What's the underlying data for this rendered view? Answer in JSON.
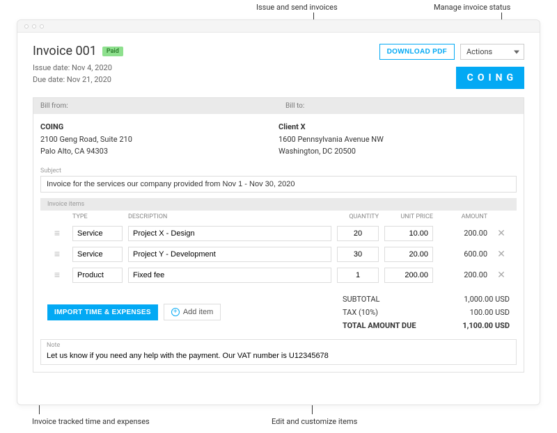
{
  "annotations": {
    "issue_send": "Issue and send invoices",
    "manage_status": "Manage invoice status",
    "invoice_tracked": "Invoice tracked time and expenses",
    "edit_items": "Edit and customize items"
  },
  "header": {
    "title": "Invoice 001",
    "status_badge": "Paid",
    "issue_date_label": "Issue date: Nov 4, 2020",
    "due_date_label": "Due date: Nov 21, 2020",
    "download_label": "DOWNLOAD PDF",
    "actions_label": "Actions",
    "logo_text": "COING"
  },
  "bill": {
    "from_label": "Bill from:",
    "to_label": "Bill to:",
    "from": {
      "company": "COING",
      "line1": "2100 Geng Road, Suite 210",
      "line2": "Palo Alto, CA 94303"
    },
    "to": {
      "company": "Client X",
      "line1": "1600 Pennsylvania Avenue NW",
      "line2": "Washington, DC 20500"
    }
  },
  "subject": {
    "label": "Subject",
    "value": "Invoice for the services our company provided from Nov 1 - Nov 30, 2020"
  },
  "items_section": {
    "label": "Invoice items",
    "cols": {
      "type": "TYPE",
      "description": "DESCRIPTION",
      "quantity": "QUANTITY",
      "unit_price": "UNIT PRICE",
      "amount": "AMOUNT"
    }
  },
  "items": [
    {
      "type": "Service",
      "description": "Project X - Design",
      "quantity": "20",
      "unit_price": "10.00",
      "amount": "200.00"
    },
    {
      "type": "Service",
      "description": "Project Y - Development",
      "quantity": "30",
      "unit_price": "20.00",
      "amount": "600.00"
    },
    {
      "type": "Product",
      "description": "Fixed fee",
      "quantity": "1",
      "unit_price": "200.00",
      "amount": "200.00"
    }
  ],
  "actions": {
    "import_label": "IMPORT TIME & EXPENSES",
    "add_item_label": "Add item"
  },
  "totals": {
    "subtotal_label": "SUBTOTAL",
    "subtotal_value": "1,000.00 USD",
    "tax_label": "TAX  (10%)",
    "tax_value": "100.00 USD",
    "total_label": "TOTAL AMOUNT DUE",
    "total_value": "1,100.00 USD"
  },
  "note": {
    "label": "Note",
    "value": "Let us know if you need any help with the payment. Our VAT number is U12345678"
  }
}
